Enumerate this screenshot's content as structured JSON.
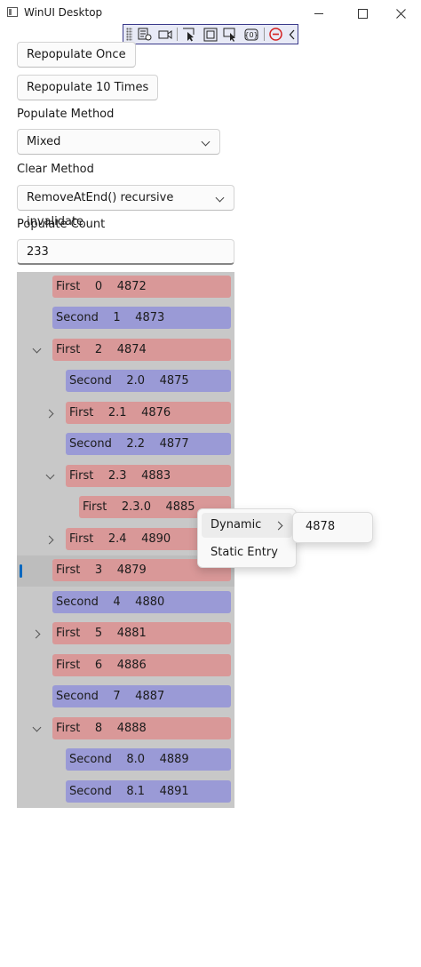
{
  "window": {
    "title": "WinUI Desktop",
    "app_icon": "window-icon"
  },
  "toolbar": {
    "icons": [
      "live-visual-tree-icon",
      "record-icon",
      "select-element-icon",
      "display-layout-adorners-icon",
      "track-focus-icon",
      "binding-failures-icon",
      "disable-icon",
      "collapse-chevron-icon"
    ]
  },
  "controls": {
    "repopulate_once": "Repopulate Once",
    "repopulate_10": "Repopulate 10 Times",
    "populate_method_label": "Populate Method",
    "populate_method_value": "Mixed",
    "clear_method_label": "Clear Method",
    "clear_method_value": "RemoveAtEnd() recursive invalidate",
    "populate_count_label": "Populate Count",
    "populate_count_value": "233"
  },
  "tree": {
    "items": [
      {
        "text": "First    0    4872",
        "color": "red"
      },
      {
        "text": "Second    1    4873",
        "color": "blue"
      },
      {
        "text": "First    2    4874",
        "color": "red"
      },
      {
        "text": "Second    2.0    4875",
        "color": "blue"
      },
      {
        "text": "First    2.1    4876",
        "color": "red"
      },
      {
        "text": "Second    2.2    4877",
        "color": "blue"
      },
      {
        "text": "First    2.3    4883",
        "color": "red"
      },
      {
        "text": "First    2.3.0    4885",
        "color": "red"
      },
      {
        "text": "First    2.4    4890",
        "color": "red"
      },
      {
        "text": "First    3    4879",
        "color": "red"
      },
      {
        "text": "Second    4    4880",
        "color": "blue"
      },
      {
        "text": "First    5    4881",
        "color": "red"
      },
      {
        "text": "First    6    4886",
        "color": "red"
      },
      {
        "text": "Second    7    4887",
        "color": "blue"
      },
      {
        "text": "First    8    4888",
        "color": "red"
      },
      {
        "text": "Second    8.0    4889",
        "color": "blue"
      },
      {
        "text": "Second    8.1    4891",
        "color": "blue"
      }
    ],
    "colors": {
      "red": "#d99898",
      "blue": "#9a9ad6",
      "selection": "#0067c0"
    }
  },
  "context_menu": {
    "dynamic": "Dynamic",
    "static_entry": "Static Entry",
    "submenu_item": "4878"
  }
}
